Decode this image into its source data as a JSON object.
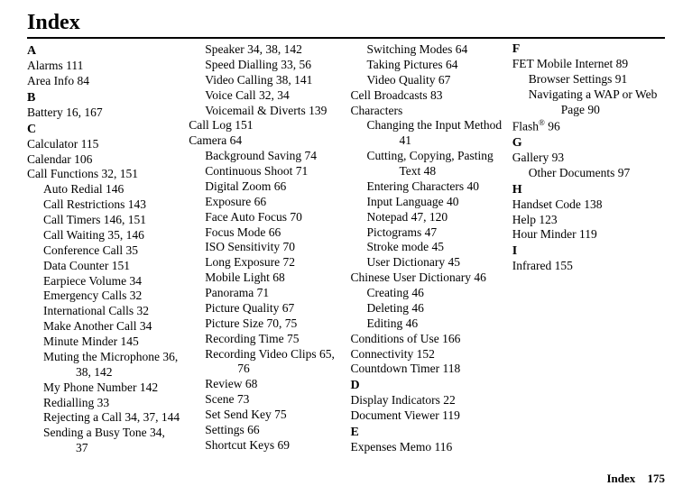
{
  "title": "Index",
  "footer": {
    "label": "Index",
    "page": "175"
  },
  "letters": {
    "A": "A",
    "B": "B",
    "C": "C",
    "D": "D",
    "E": "E",
    "F": "F",
    "G": "G",
    "H": "H",
    "I": "I"
  },
  "e": {
    "alarms": "Alarms 111",
    "areainfo": "Area Info 84",
    "battery": "Battery 16, 167",
    "calculator": "Calculator 115",
    "calendar": "Calendar 106",
    "callfunctions": "Call Functions 32, 151",
    "autoredial": "Auto Redial 146",
    "callrestrictions": "Call Restrictions 143",
    "calltimers": "Call Timers 146, 151",
    "callwaiting": "Call Waiting 35, 146",
    "conferencecall": "Conference Call 35",
    "datacounter": "Data Counter 151",
    "earpiecevolume": "Earpiece Volume 34",
    "emergencycalls": "Emergency Calls 32",
    "internationalcalls": "International Calls 32",
    "makeanothercall": "Make Another Call 34",
    "minuteminder": "Minute Minder 145",
    "mutingmic": "Muting the Microphone 36, 38, 142",
    "myphonenumber": "My Phone Number 142",
    "redialling": "Redialling 33",
    "rejectingcall": "Rejecting a Call 34, 37, 144",
    "sendingbusy": "Sending a Busy Tone 34, 37",
    "speaker": "Speaker 34, 38, 142",
    "speeddialling": "Speed Dialling 33, 56",
    "videocalling": "Video Calling 38, 141",
    "voicecall": "Voice Call 32, 34",
    "voicemaildiverts": "Voicemail & Diverts 139",
    "calllog": "Call Log 151",
    "camera": "Camera 64",
    "backgroundsaving": "Background Saving 74",
    "continuousshoot": "Continuous Shoot 71",
    "digitalzoom": "Digital Zoom 66",
    "exposure": "Exposure 66",
    "faceautofocus": "Face Auto Focus 70",
    "focusmode": "Focus Mode 66",
    "isosensitivity": "ISO Sensitivity 70",
    "longexposure": "Long Exposure 72",
    "mobilelight": "Mobile Light 68",
    "panorama": "Panorama 71",
    "picturequality": "Picture Quality 67",
    "picturesize": "Picture Size 70, 75",
    "recordingtime": "Recording Time 75",
    "recordingvideoclips": "Recording Video Clips 65, 76",
    "review": "Review 68",
    "scene": "Scene 73",
    "setsendkey": "Set Send Key 75",
    "settings": "Settings 66",
    "shortcutkeys": "Shortcut Keys 69",
    "switchingmodes": "Switching Modes 64",
    "takingpictures": "Taking Pictures 64",
    "videoquality": "Video Quality 67",
    "cellbroadcasts": "Cell Broadcasts 83",
    "characters": "Characters",
    "changinginputmethod": "Changing the Input Method 41",
    "cuttingcopyingpasting": "Cutting, Copying, Pasting Text 48",
    "enteringcharacters": "Entering Characters 40",
    "inputlanguage": "Input Language 40",
    "notepad": "Notepad 47, 120",
    "pictograms": "Pictograms 47",
    "strokemode": "Stroke mode 45",
    "userdictionary": "User Dictionary 45",
    "chineseuserdictionary": "Chinese User Dictionary 46",
    "creating": "Creating 46",
    "deleting": "Deleting 46",
    "editing": "Editing 46",
    "conditionsofuse": "Conditions of Use 166",
    "connectivity": "Connectivity 152",
    "countdowntimer": "Countdown Timer 118",
    "displayindicators": "Display Indicators 22",
    "documentviewer": "Document Viewer 119",
    "expensesmemo": "Expenses Memo 116",
    "fetmobileinternet": "FET Mobile Internet 89",
    "browsersettings": "Browser Settings 91",
    "navigatingwap": "Navigating a WAP or Web Page 90",
    "flash_prefix": "Flash",
    "flash_suffix": " 96",
    "gallery": "Gallery 93",
    "otherdocuments": "Other Documents 97",
    "handsetcode": "Handset Code 138",
    "help": "Help 123",
    "hourminder": "Hour Minder 119",
    "infrared": "Infrared 155"
  }
}
